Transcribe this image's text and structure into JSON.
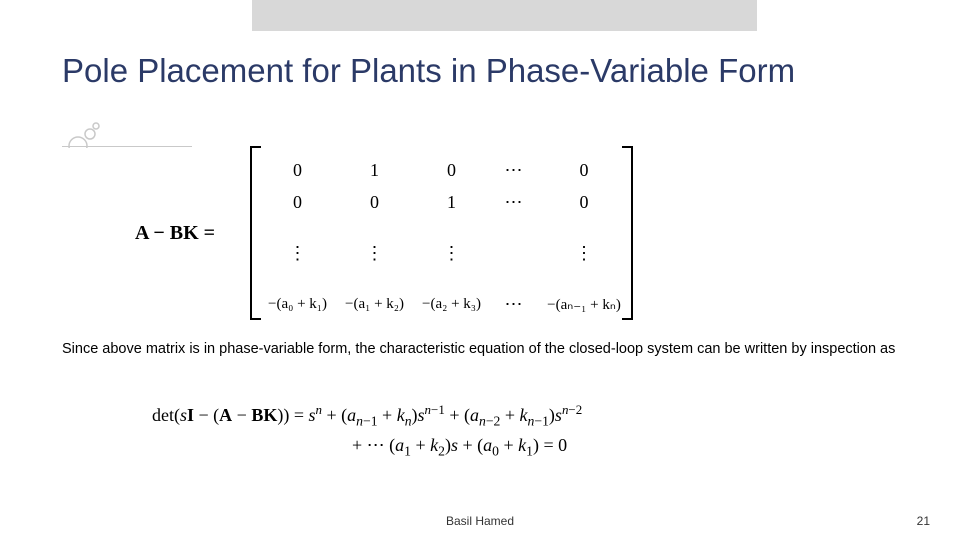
{
  "title": "Pole Placement for Plants in Phase-Variable Form",
  "matrix": {
    "prefix": "A − BK =",
    "rows": [
      [
        "0",
        "1",
        "0",
        "⋯",
        "0"
      ],
      [
        "0",
        "0",
        "1",
        "⋯",
        "0"
      ],
      [
        "⋮",
        "⋮",
        "⋮",
        "",
        "⋮"
      ],
      [
        "−(a₀ + k₁)",
        "−(a₁ + k₂)",
        "−(a₂ + k₃)",
        "⋯",
        "−(aₙ₋₁ + kₙ)"
      ]
    ]
  },
  "body_text": "Since above matrix is in phase-variable form, the characteristic equation of the closed-loop system can be written by inspection as",
  "equation": {
    "line1_html": "det(<i>s</i><b>I</b> − (<b>A</b> − <b>BK</b>)) = <i>s</i><sup><i>n</i></sup> + (<i>a</i><sub><i>n</i>−1</sub> + <i>k</i><sub><i>n</i></sub>)<i>s</i><sup><i>n</i>−1</sup> + (<i>a</i><sub><i>n</i>−2</sub> + <i>k</i><sub><i>n</i>−1</sub>)<i>s</i><sup><i>n</i>−2</sup>",
    "line2_html": "+ ⋯ (<i>a</i><sub>1</sub> + <i>k</i><sub>2</sub>)<i>s</i> + (<i>a</i><sub>0</sub> + <i>k</i><sub>1</sub>) = 0"
  },
  "footer": {
    "center": "Basil Hamed",
    "page_number": "21"
  }
}
